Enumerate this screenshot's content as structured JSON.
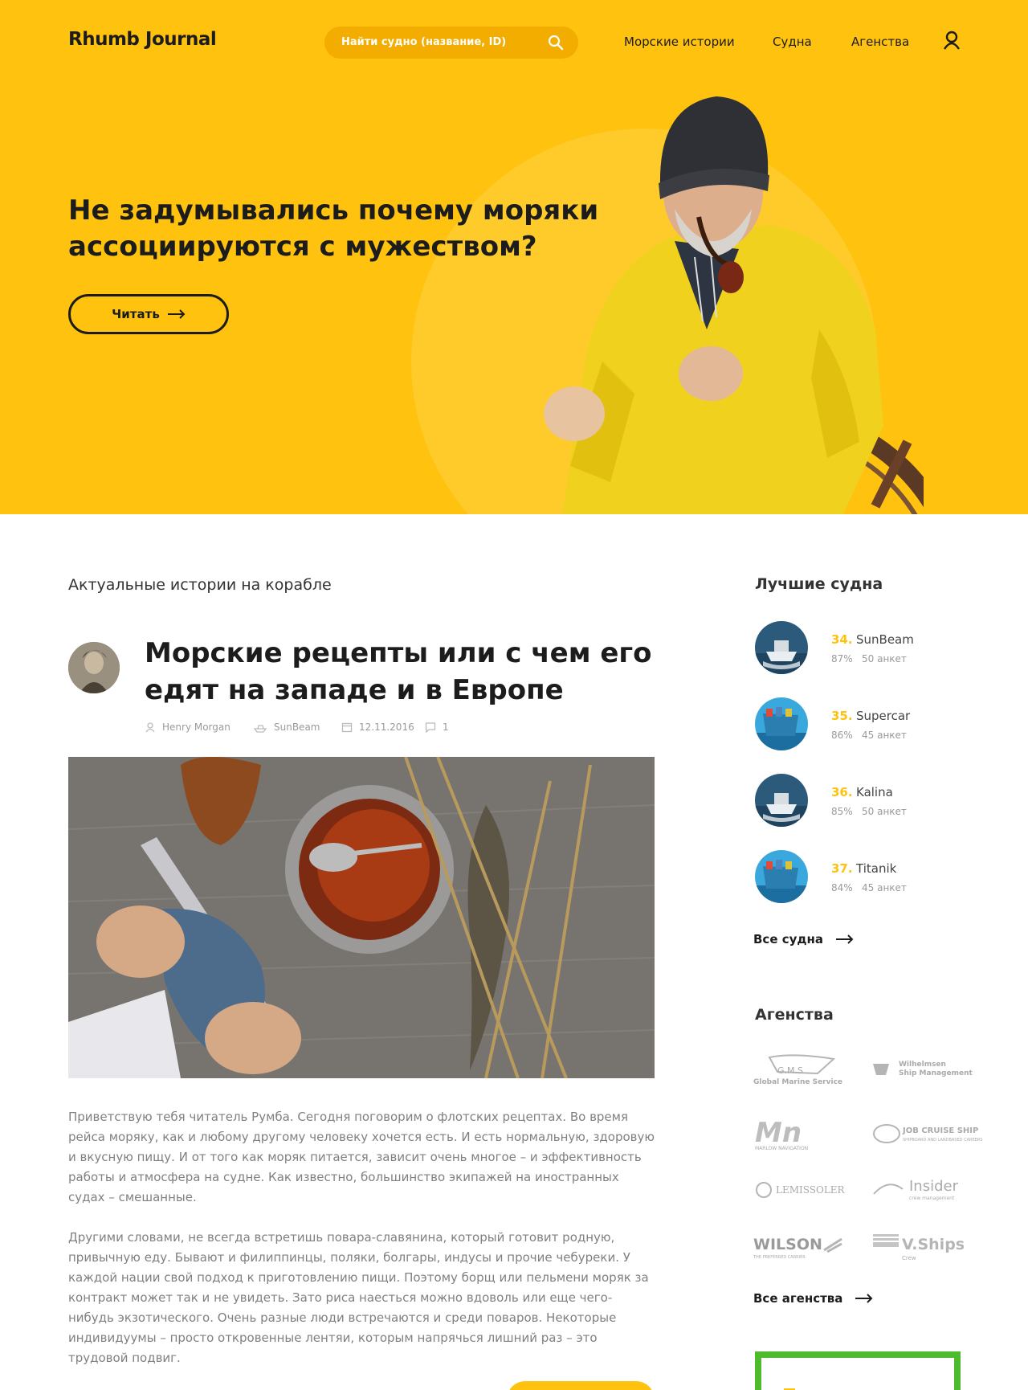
{
  "header": {
    "logo": "Rhumb Journal",
    "search_placeholder": "Найти судно (название, ID)",
    "nav": [
      "Морские истории",
      "Судна",
      "Агенства"
    ]
  },
  "hero": {
    "title": "Не задумывались почему моряки ассоциируются с мужеством?",
    "button_label": "Читать"
  },
  "main": {
    "section_title": "Актуальные истории на корабле",
    "article": {
      "title": "Морские рецепты или с чем его едят на западе и в Европе",
      "author": "Henry Morgan",
      "ship": "SunBeam",
      "date": "12.11.2016",
      "comments": "1",
      "paragraphs": [
        "Приветствую тебя читатель Румба. Сегодня поговорим о флотских рецептах. Во время рейса моряку, как и любому другому человеку хочется есть. И есть нормальную, здоровую и вкусную пищу. И от того как моряк питается, зависит очень многое – и эффективность работы и атмосфера на судне. Как известно, большинство экипажей на иностранных судах – смешанные.",
        "Другими словами, не всегда встретишь повара-славянина, который готовит родную, привычную еду. Бывают и филиппинцы, поляки, болгары, индусы и прочие чебуреки. У каждой нации свой подход к приготовлению пищи. Поэтому борщ или пельмени моряк за контракт может так и не увидеть. Зато риса наесться можно вдоволь или еще чего-нибудь экзотического. Очень разные люди встречаются и среди поваров. Некоторые индивидуумы – просто откровенные лентяи, которым напрячься лишний раз – это трудовой подвиг."
      ]
    }
  },
  "sidebar": {
    "ships_title": "Лучшие судна",
    "ships": [
      {
        "rank": "34.",
        "name": "SunBeam",
        "pct": "87%",
        "count": "50 анкет"
      },
      {
        "rank": "35.",
        "name": "Supercar",
        "pct": "86%",
        "count": "45 анкет"
      },
      {
        "rank": "36.",
        "name": "Kalina",
        "pct": "85%",
        "count": "50 анкет"
      },
      {
        "rank": "37.",
        "name": "Titanik",
        "pct": "84%",
        "count": "45 анкет"
      }
    ],
    "all_ships": "Все судна",
    "agencies_title": "Агенства",
    "agencies": [
      {
        "name": "G.M.S",
        "sub": "Global Marine Service"
      },
      {
        "name": "Wilhelmsen",
        "sub": "Ship Management"
      },
      {
        "name": "Mn",
        "sub": "MARLOW NAVIGATION"
      },
      {
        "name": "JOB CRUISE SHIP",
        "sub": "SHIPBOARD AND LANDBASED CAREERS"
      },
      {
        "name": "LEMISSOLER",
        "sub": ""
      },
      {
        "name": "Insider",
        "sub": "crew management"
      },
      {
        "name": "WILSON",
        "sub": "THE PREFERRED CARRIER"
      },
      {
        "name": "V.Ships",
        "sub": "Crew"
      }
    ],
    "all_agencies": "Все агенства"
  },
  "colors": {
    "accent": "#ffc20e",
    "ad_border": "#4cbc2e"
  }
}
